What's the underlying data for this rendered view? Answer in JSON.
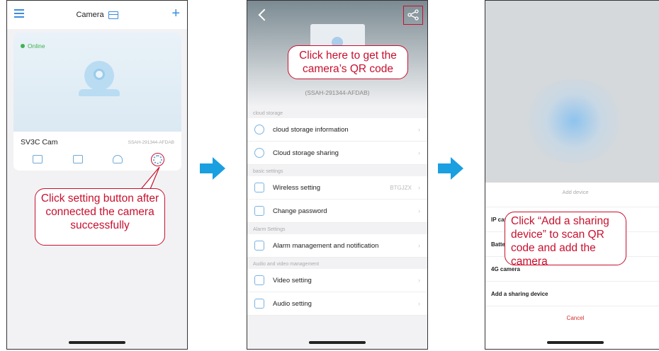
{
  "phone1": {
    "title": "Camera",
    "status": "Online",
    "camera_name": "SV3C Cam",
    "camera_id": "SSAH-291344-AFDAB",
    "callout": "Click setting button after connected the camera successfully"
  },
  "phone2": {
    "serial": "(SSAH-291344-AFDAB)",
    "callout": "Click here to get the camera’s QR code",
    "sections": {
      "cloud": "cloud storage",
      "basic": "basic settings",
      "alarm": "Alarm Settings",
      "av": "Audio and video management"
    },
    "rows": {
      "cloud_info": "cloud storage information",
      "cloud_share": "Cloud storage sharing",
      "wireless": "Wireless setting",
      "wireless_value": "BTGJZX",
      "password": "Change password",
      "alarm": "Alarm management and notification",
      "video": "Video setting",
      "audio": "Audio setting"
    }
  },
  "phone3": {
    "sheet_title": "Add device",
    "rows": {
      "ip": "IP camera",
      "battery": "Battery camera",
      "fourg": "4G camera",
      "sharing": "Add a sharing device"
    },
    "cancel": "Cancel",
    "callout": "Click “Add a sharing device” to scan QR code and add the camera"
  },
  "colors": {
    "callout": "#c8102e",
    "arrow": "#1a9fe0",
    "online": "#3fb34f",
    "accent": "#3a8de0"
  }
}
